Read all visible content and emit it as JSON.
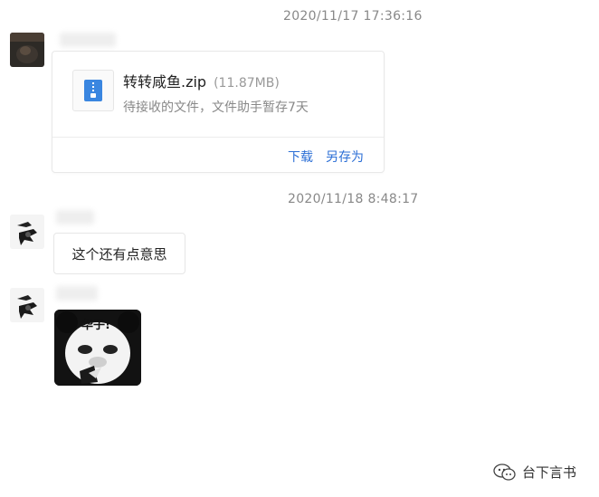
{
  "messages": {
    "timestamp1": "2020/11/17 17:36:16",
    "timestamp2": "2020/11/18 8:48:17",
    "file": {
      "name": "转转咸鱼.zip",
      "size": "(11.87MB)",
      "status": "待接收的文件，文件助手暂存7天",
      "download_label": "下载",
      "save_as_label": "另存为"
    },
    "text_message": "这个还有点意思",
    "sticker_text": "华子!"
  },
  "watermark": "台下言书",
  "colors": {
    "link": "#2c6fd6",
    "file_icon": "#3a86e0"
  }
}
